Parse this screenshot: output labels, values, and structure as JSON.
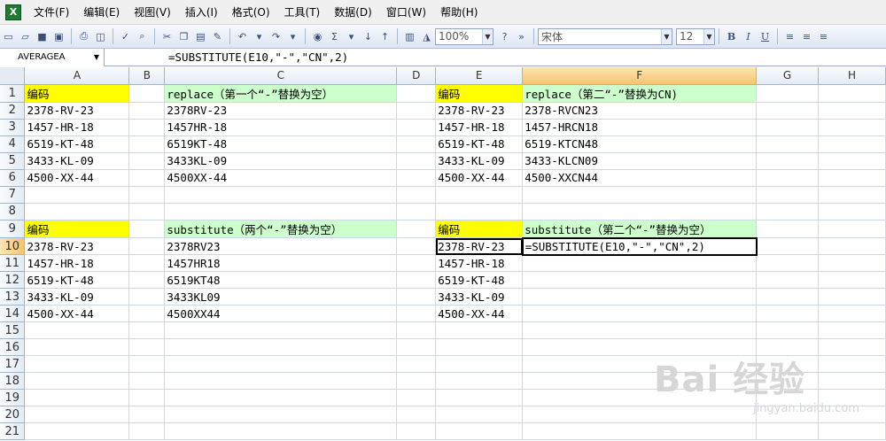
{
  "menu": {
    "app_icon": "X",
    "items": [
      "文件(F)",
      "编辑(E)",
      "视图(V)",
      "插入(I)",
      "格式(O)",
      "工具(T)",
      "数据(D)",
      "窗口(W)",
      "帮助(H)"
    ]
  },
  "toolbar": {
    "zoom": "100%",
    "font": "宋体",
    "font_size": "12",
    "bold": "B",
    "italic": "I",
    "underline": "U",
    "sum": "Σ"
  },
  "formula_bar": {
    "name_box": "AVERAGEA",
    "formula": "=SUBSTITUTE(E10,\"-\",\"CN\",2)"
  },
  "sheet": {
    "columns": [
      "A",
      "B",
      "C",
      "D",
      "E",
      "F",
      "G",
      "H"
    ],
    "active_column": "F",
    "active_row": 10,
    "rows": [
      {
        "n": "1",
        "A": "编码",
        "C": "replace（第一个“-”替换为空）",
        "E": "编码",
        "F": "replace（第二“-”替换为CN)"
      },
      {
        "n": "2",
        "A": "2378-RV-23",
        "C": "2378RV-23",
        "E": "2378-RV-23",
        "F": "2378-RVCN23"
      },
      {
        "n": "3",
        "A": "1457-HR-18",
        "C": "1457HR-18",
        "E": "1457-HR-18",
        "F": "1457-HRCN18"
      },
      {
        "n": "4",
        "A": "6519-KT-48",
        "C": "6519KT-48",
        "E": "6519-KT-48",
        "F": "6519-KTCN48"
      },
      {
        "n": "5",
        "A": "3433-KL-09",
        "C": "3433KL-09",
        "E": "3433-KL-09",
        "F": "3433-KLCN09"
      },
      {
        "n": "6",
        "A": "4500-XX-44",
        "C": "4500XX-44",
        "E": "4500-XX-44",
        "F": "4500-XXCN44"
      },
      {
        "n": "7",
        "A": "",
        "C": "",
        "E": "",
        "F": ""
      },
      {
        "n": "8",
        "A": "",
        "C": "",
        "E": "",
        "F": ""
      },
      {
        "n": "9",
        "A": "编码",
        "C": "substitute（两个“-”替换为空）",
        "E": "编码",
        "F": "substitute（第二个“-”替换为空）"
      },
      {
        "n": "10",
        "A": "2378-RV-23",
        "C": "2378RV23",
        "E": "2378-RV-23",
        "F": "=SUBSTITUTE(E10,\"-\",\"CN\",2)"
      },
      {
        "n": "11",
        "A": "1457-HR-18",
        "C": "1457HR18",
        "E": "1457-HR-18",
        "F": ""
      },
      {
        "n": "12",
        "A": "6519-KT-48",
        "C": "6519KT48",
        "E": "6519-KT-48",
        "F": ""
      },
      {
        "n": "13",
        "A": "3433-KL-09",
        "C": "3433KL09",
        "E": "3433-KL-09",
        "F": ""
      },
      {
        "n": "14",
        "A": "4500-XX-44",
        "C": "4500XX44",
        "E": "4500-XX-44",
        "F": ""
      },
      {
        "n": "15",
        "A": "",
        "C": "",
        "E": "",
        "F": ""
      },
      {
        "n": "16",
        "A": "",
        "C": "",
        "E": "",
        "F": ""
      },
      {
        "n": "17",
        "A": "",
        "C": "",
        "E": "",
        "F": ""
      },
      {
        "n": "18",
        "A": "",
        "C": "",
        "E": "",
        "F": ""
      },
      {
        "n": "19",
        "A": "",
        "C": "",
        "E": "",
        "F": ""
      },
      {
        "n": "20",
        "A": "",
        "C": "",
        "E": "",
        "F": ""
      },
      {
        "n": "21",
        "A": "",
        "C": "",
        "E": "",
        "F": ""
      }
    ],
    "header_fill": "#ffff00",
    "title_fill": "#ccffcc"
  },
  "watermark": {
    "brand": "Bai 经验",
    "url": "jingyan.baidu.com"
  }
}
